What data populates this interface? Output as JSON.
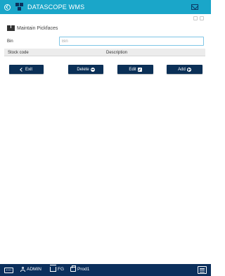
{
  "topbar": {
    "app_title": "DATASCOPE WMS",
    "icons": [
      "back-icon",
      "logo-icon",
      "mail-icon"
    ],
    "color": "#1aa6c9"
  },
  "toolbar": {
    "icons": [
      "print-icon",
      "settings-icon"
    ]
  },
  "page": {
    "title": "Maintain Pickfaces",
    "icon": "boxes-icon"
  },
  "form": {
    "bin_label": "Bin",
    "bin_value": "",
    "bin_placeholder": "Bin"
  },
  "grid": {
    "columns": [
      "Stock code",
      "Description"
    ],
    "rows": []
  },
  "buttons": {
    "exit": "Exit",
    "delete": "Delete",
    "edit": "Edit",
    "add": "Add",
    "color": "#0b3057"
  },
  "bottombar": {
    "user": "ADMIN",
    "warehouse": "FG",
    "printer": "Prod1",
    "icons": [
      "keyboard-icon",
      "user-icon",
      "warehouse-icon",
      "printer-icon",
      "menu-icon"
    ],
    "color": "#0b2f5c"
  }
}
